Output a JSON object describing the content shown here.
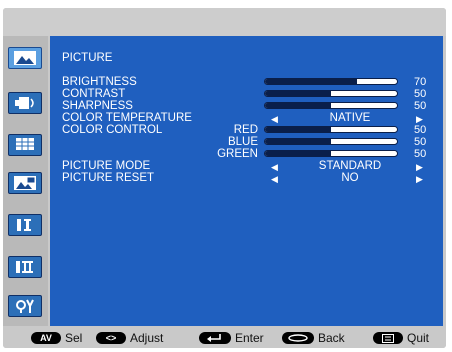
{
  "menu": {
    "title": "PICTURE",
    "rows": [
      {
        "label": "BRIGHTNESS",
        "value": "70",
        "level": 0.7
      },
      {
        "label": "CONTRAST",
        "value": "50",
        "level": 0.5
      },
      {
        "label": "SHARPNESS",
        "value": "50",
        "level": 0.5
      },
      {
        "label": "COLOR TEMPERATURE",
        "option": "NATIVE"
      },
      {
        "label": "COLOR CONTROL",
        "sublabel": "RED",
        "value": "50",
        "level": 0.5
      },
      {
        "sublabel": "BLUE",
        "value": "50",
        "level": 0.5
      },
      {
        "sublabel": "GREEN",
        "value": "50",
        "level": 0.5
      },
      {
        "label": "PICTURE MODE",
        "option": "STANDARD"
      },
      {
        "label": "PICTURE RESET",
        "option": "NO"
      }
    ]
  },
  "sidebar": {
    "icons": [
      "picture-icon",
      "audio-icon",
      "screen-icon",
      "pip-icon",
      "setup1-icon",
      "setup2-icon",
      "options-icon"
    ]
  },
  "footer": {
    "sel_key": "AV",
    "sel_label": "Sel",
    "adjust_key": "<>",
    "adjust_label": "Adjust",
    "enter_label": "Enter",
    "back_label": "Back",
    "quit_label": "Quit"
  }
}
